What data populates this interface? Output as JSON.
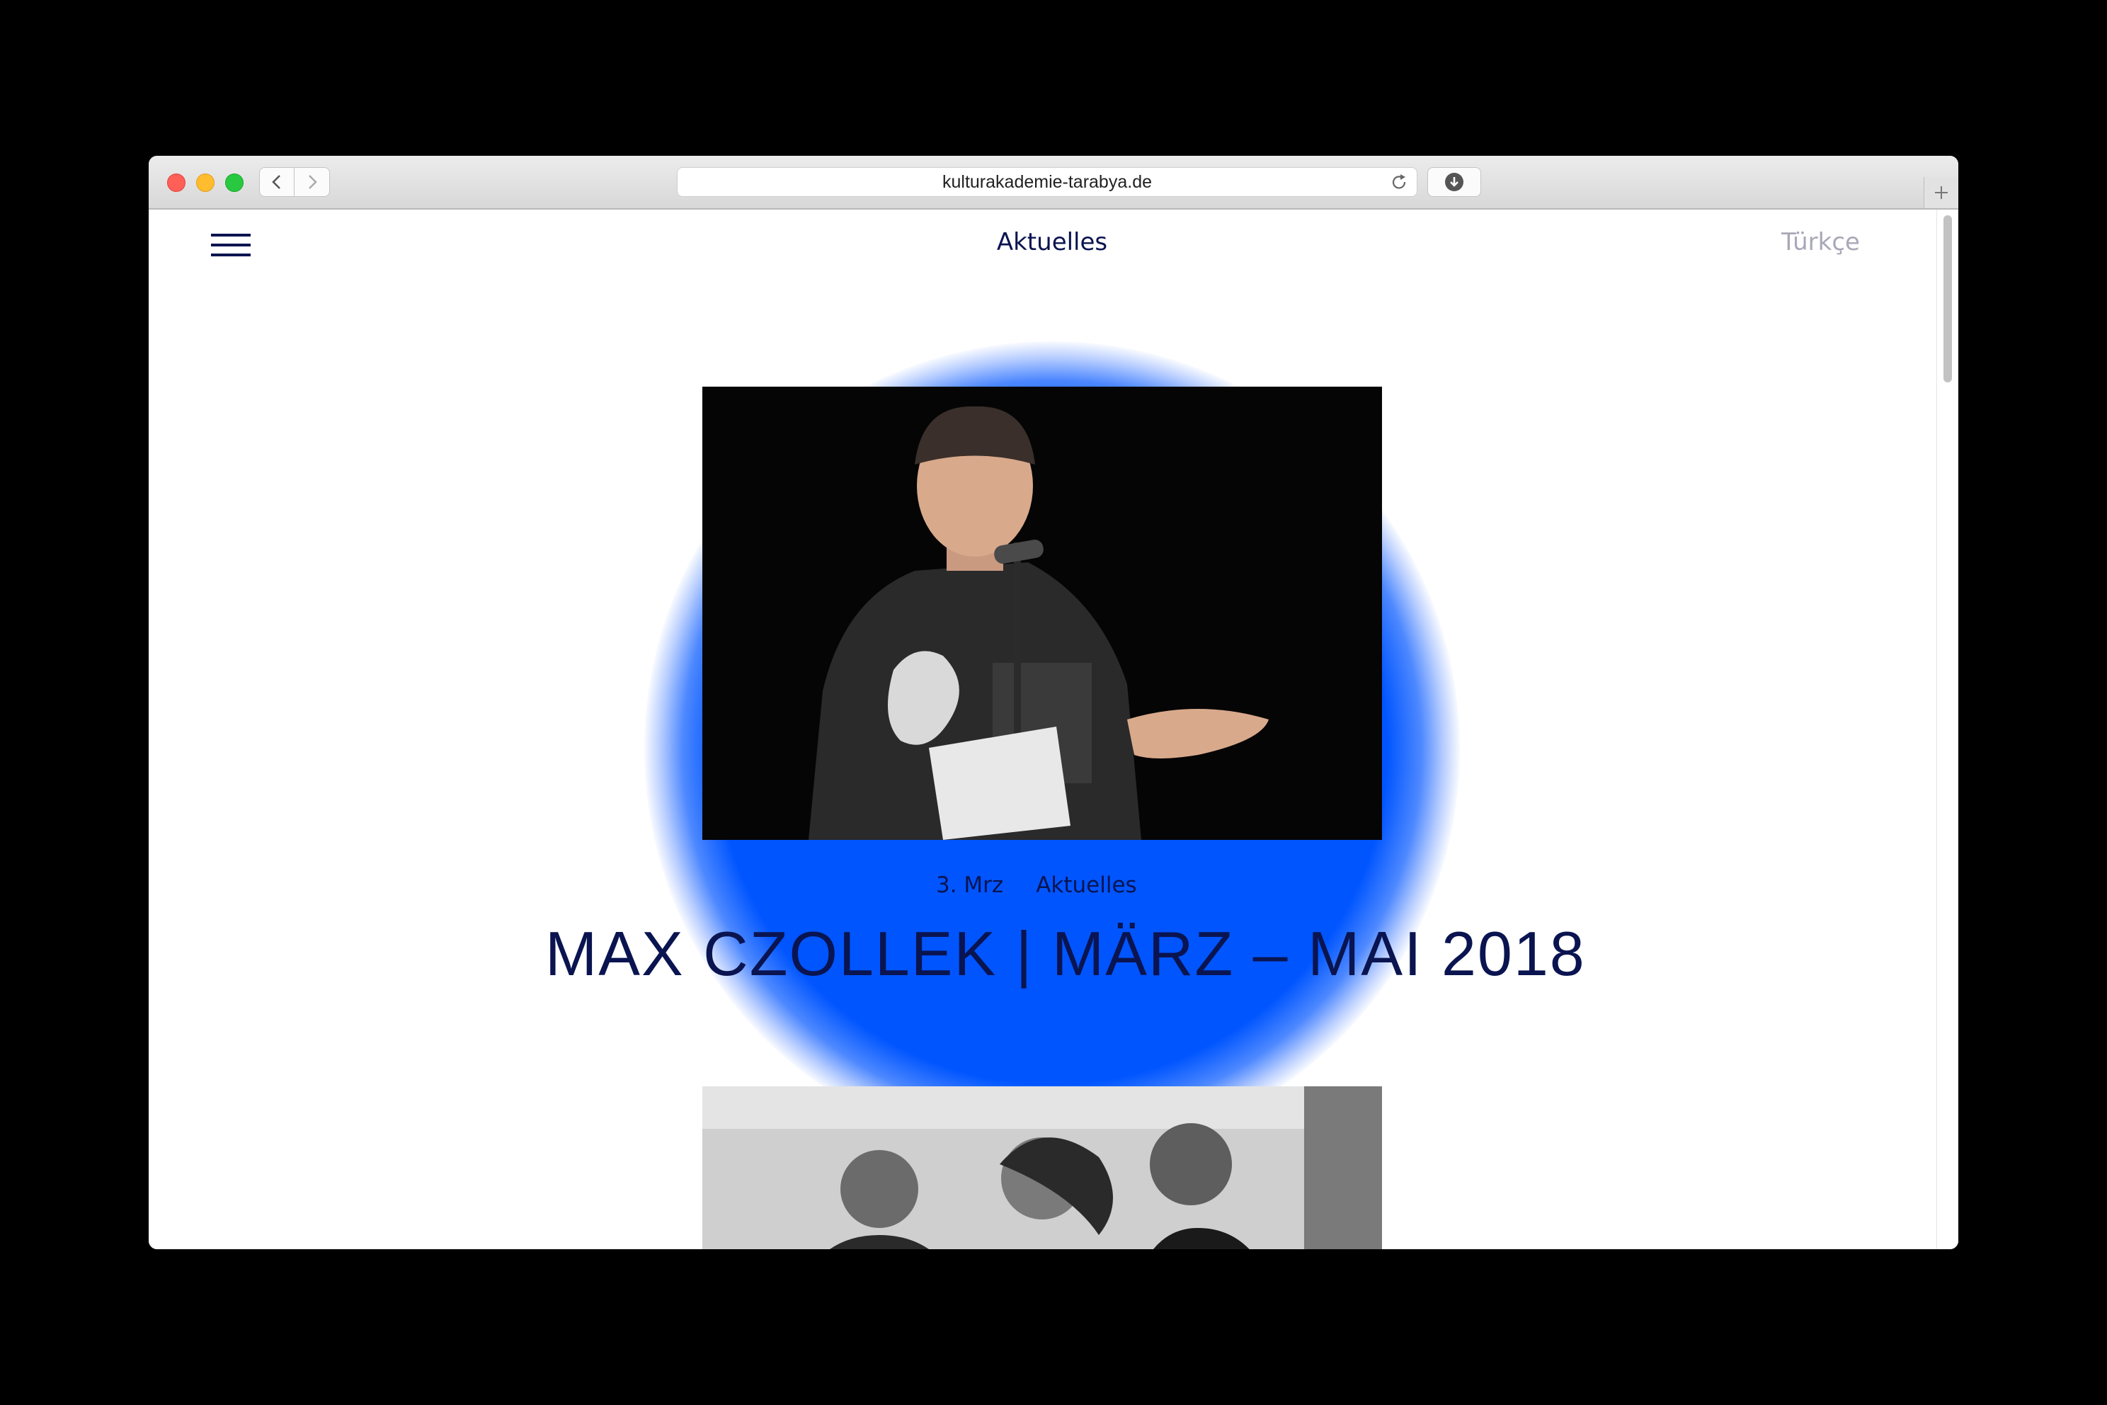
{
  "browser": {
    "url": "kulturakademie-tarabya.de",
    "icons": {
      "close": "close-dot-icon",
      "minimize": "minimize-dot-icon",
      "maximize": "maximize-dot-icon",
      "back": "chevron-left-icon",
      "forward": "chevron-right-icon",
      "reload": "reload-icon",
      "download": "download-icon",
      "new_tab": "plus-icon"
    }
  },
  "site": {
    "nav_title": "Aktuelles",
    "language_link": "Türkçe",
    "menu_icon": "hamburger-menu-icon",
    "accent_color": "#0055ff",
    "text_color": "#0a1450"
  },
  "posts": [
    {
      "date": "3. Mrz",
      "category": "Aktuelles",
      "title": "MAX CZOLLEK | MÄRZ – MAI 2018"
    }
  ]
}
